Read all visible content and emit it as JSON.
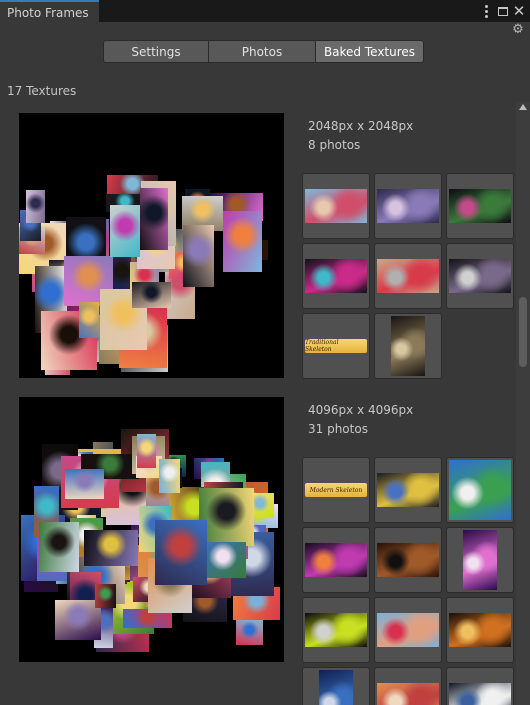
{
  "window": {
    "tab_title": "Photo Frames",
    "close_glyph": "✕",
    "settings_glyph": "⚙",
    "icons": [
      "more-options-icon",
      "maximize-icon",
      "close-icon",
      "gear-icon"
    ]
  },
  "toolbar": {
    "tabs": [
      {
        "label": "Settings",
        "active": false
      },
      {
        "label": "Photos",
        "active": false
      },
      {
        "label": "Baked Textures",
        "active": true
      }
    ]
  },
  "summary": {
    "texture_count": "17 Textures"
  },
  "textures": [
    {
      "size": "2048px x 2048px",
      "photos": "8 photos",
      "thumbnails": [
        {
          "kind": "wide",
          "colors": [
            "#7fb8d8",
            "#d04e6a",
            "#e8c9b0"
          ]
        },
        {
          "kind": "wide",
          "colors": [
            "#2e2a4e",
            "#8a7ab8",
            "#d7c2e0"
          ]
        },
        {
          "kind": "wide",
          "colors": [
            "#0c0c12",
            "#3a7a3a",
            "#c44a8a"
          ]
        },
        {
          "kind": "wide",
          "colors": [
            "#10101a",
            "#cc2a8a",
            "#3fb8c8"
          ]
        },
        {
          "kind": "wide",
          "colors": [
            "#c9a98a",
            "#d83a4a",
            "#b0b0b0"
          ]
        },
        {
          "kind": "wide",
          "colors": [
            "#121216",
            "#7a6a8a",
            "#d0d0d0"
          ]
        },
        {
          "kind": "banner",
          "text": "Traditional Skeleton",
          "colors": [
            "#e7b23a",
            "#f5d777"
          ]
        },
        {
          "kind": "tall",
          "colors": [
            "#1a1410",
            "#8a7a5a",
            "#d8c8a0"
          ]
        }
      ]
    },
    {
      "size": "4096px x 4096px",
      "photos": "31 photos",
      "thumbnails": [
        {
          "kind": "banner",
          "text": "Modern Skeleton",
          "colors": [
            "#e7b23a",
            "#f5d777"
          ]
        },
        {
          "kind": "wide",
          "colors": [
            "#1a1a22",
            "#e0c040",
            "#4a70c0"
          ]
        },
        {
          "kind": "sq",
          "colors": [
            "#2f6fd0",
            "#3aa050",
            "#f0f0f0"
          ]
        },
        {
          "kind": "wide",
          "colors": [
            "#160c20",
            "#c03ab0",
            "#f08040"
          ]
        },
        {
          "kind": "wide",
          "colors": [
            "#2a1208",
            "#a05a2a",
            "#101010"
          ]
        },
        {
          "kind": "tall",
          "colors": [
            "#2a0a4a",
            "#e070d0",
            "#f0e0f0"
          ]
        },
        {
          "kind": "wide",
          "colors": [
            "#0a0a0a",
            "#c8e020",
            "#d0d0d0"
          ]
        },
        {
          "kind": "wide",
          "colors": [
            "#7ab0d8",
            "#e0a080",
            "#d83050"
          ]
        },
        {
          "kind": "wide",
          "colors": [
            "#1a0e08",
            "#d07020",
            "#f0c060"
          ]
        },
        {
          "kind": "tall",
          "colors": [
            "#102050",
            "#3a70c0",
            "#d0d8e8"
          ]
        },
        {
          "kind": "wide",
          "colors": [
            "#e09050",
            "#c04040",
            "#f0d8c0"
          ]
        },
        {
          "kind": "wide",
          "colors": [
            "#101828",
            "#f0f0f0",
            "#3a60a0"
          ]
        }
      ]
    }
  ]
}
